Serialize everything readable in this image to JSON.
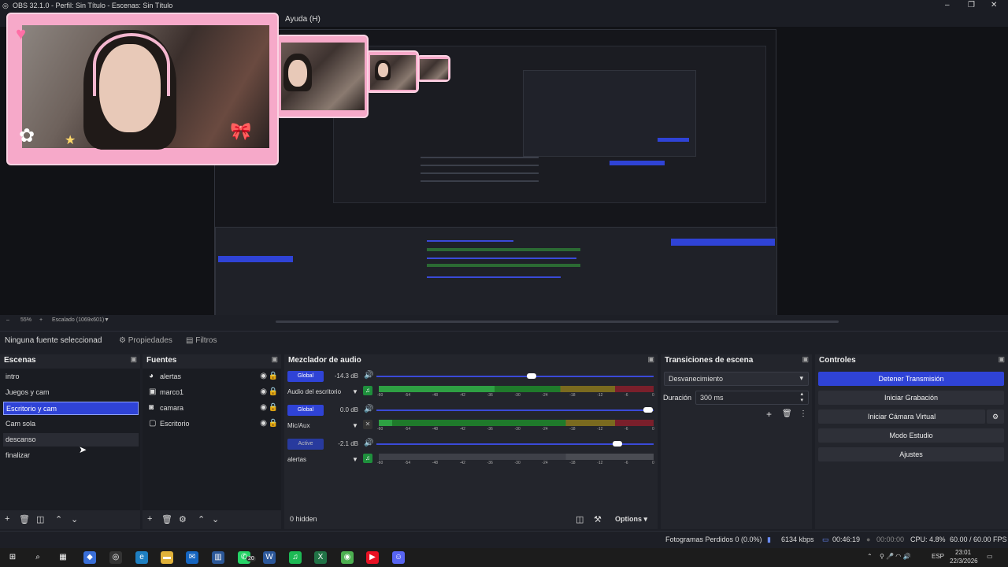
{
  "window": {
    "title": "OBS 32.1.0 - Perfil: Sin Título - Escenas: Sin Título",
    "controls": [
      "–",
      "❐",
      "✕"
    ]
  },
  "menu": {
    "help": "Ayuda (H)"
  },
  "preview": {
    "zoom": "55%",
    "scale_label": "Escalado (1069x601)"
  },
  "props_bar": {
    "no_source": "Ninguna fuente seleccionad",
    "properties": "Propiedades",
    "filters": "Filtros"
  },
  "scenes": {
    "title": "Escenas",
    "items": [
      "intro",
      "Juegos y cam",
      "Escritorio y cam",
      "Cam sola",
      "descanso",
      "finalizar"
    ],
    "selected_index": 2
  },
  "sources": {
    "title": "Fuentes",
    "items": [
      {
        "name": "alertas",
        "icon": "browser-icon"
      },
      {
        "name": "marco1",
        "icon": "image-icon"
      },
      {
        "name": "camara",
        "icon": "camera-icon"
      },
      {
        "name": "Escritorio",
        "icon": "monitor-icon"
      }
    ]
  },
  "mixer": {
    "title": "Mezclador de audio",
    "hidden": "0 hidden",
    "options": "Options",
    "channels": [
      {
        "badge": "Global",
        "db": "-14.3 dB",
        "name": "Audio del escritorio",
        "volume": 0.56
      },
      {
        "badge": "Global",
        "db": "0.0 dB",
        "name": "Mic/Aux",
        "volume": 0.98
      },
      {
        "badge": "Active",
        "db": "-2.1 dB",
        "name": "alertas",
        "volume": 0.87
      }
    ],
    "scale": [
      "-60",
      "-54",
      "-48",
      "-42",
      "-36",
      "-30",
      "-24",
      "-18",
      "-12",
      "-6",
      "0"
    ]
  },
  "transitions": {
    "title": "Transiciones de escena",
    "type": "Desvanecimiento",
    "duration_label": "Duración",
    "duration_value": "300 ms"
  },
  "controls": {
    "title": "Controles",
    "stop_stream": "Detener Transmisión",
    "start_recording": "Iniciar Grabación",
    "virtual_cam": "Iniciar Cámara Virtual",
    "studio_mode": "Modo Estudio",
    "settings": "Ajustes"
  },
  "status": {
    "dropped": "Fotogramas Perdidos 0 (0.0%)",
    "bitrate": "6134 kbps",
    "stream_time": "00:46:19",
    "rec_time": "00:00:00",
    "cpu": "CPU: 4.8%",
    "fps": "60.00 / 60.00 FPS"
  },
  "taskbar": {
    "lang": "ESP",
    "time": "23:01",
    "date": "22/3/2026",
    "whatsapp_badge": "20"
  },
  "colors": {
    "accent": "#2f43d6",
    "meter_green": "#1f7a2b",
    "meter_yellow": "#7a6a1f",
    "meter_red": "#7a1f2b"
  }
}
